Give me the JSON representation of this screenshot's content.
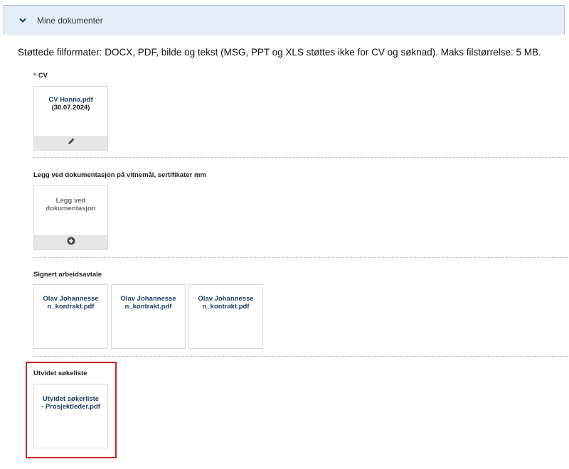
{
  "panel": {
    "title": "Mine dokumenter",
    "expand_icon": "chevron-down-icon"
  },
  "formats_note": "Støttede filformater: DOCX, PDF, bilde og tekst (MSG, PPT og XLS støttes ikke for CV og søknad). Maks filstørrelse: 5 MB.",
  "sections": {
    "cv": {
      "required_marker": "*",
      "label": "CV",
      "file_name": "CV Hanna.pdf",
      "file_date": "(30.07.2024)",
      "action_icon": "pencil-icon"
    },
    "documentation": {
      "label": "Legg ved dokumentasjon på vitnemål, sertifikater mm",
      "add_label": "Legg ved dokumentasjon",
      "action_icon": "plus-circle-icon"
    },
    "contract": {
      "label": "Signert arbeidsavtale",
      "files": [
        "Olav Johannessen_kontrakt.pdf",
        "Olav Johannessen_kontrakt.pdf",
        "Olav Johannessen_kontrakt.pdf"
      ]
    },
    "search_list": {
      "label": "Utvidet søkeliste",
      "file_name": "Utvidet søkerliste - Prosjektleder.pdf"
    }
  },
  "colors": {
    "header_bg": "#e3eef8",
    "file_link": "#1c3a5e",
    "required": "#d42a2a",
    "highlight": "#d42121"
  }
}
